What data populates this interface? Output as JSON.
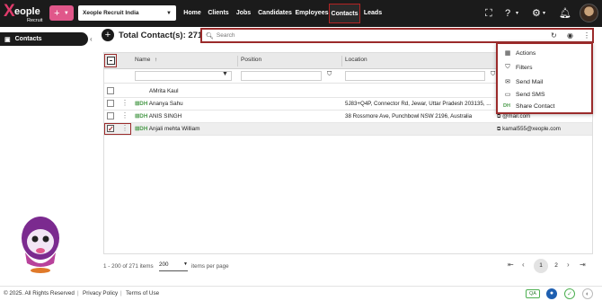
{
  "app": {
    "logo_main": "Xeople",
    "logo_x": "X",
    "logo_word": "eople",
    "logo_sub": "Recruit",
    "company": "Xeople Recruit India"
  },
  "nav": {
    "items": [
      {
        "label": "Home"
      },
      {
        "label": "Clients"
      },
      {
        "label": "Jobs"
      },
      {
        "label": "Candidates"
      },
      {
        "label": "Employees"
      },
      {
        "label": "Contacts",
        "active": true
      },
      {
        "label": "Leads"
      }
    ]
  },
  "sidebar": {
    "contacts_label": "Contacts"
  },
  "page": {
    "title": "Total Contact(s): 271"
  },
  "search": {
    "placeholder": "Search"
  },
  "grid": {
    "columns": {
      "name": "Name",
      "position": "Position",
      "location": "Location"
    },
    "rows": [
      {
        "name": "AMrita Kaul",
        "prefix": "",
        "location": "",
        "email": "",
        "selected": false
      },
      {
        "name": "Ananya Sahu",
        "prefix": "DH",
        "location": "5J83+Q4P, Connector Rd, Jewar, Uttar Pradesh 203135, ...",
        "email": "",
        "selected": false
      },
      {
        "name": "ANIS SINGH",
        "prefix": "DH",
        "location": "38 Rossmore Ave, Punchbowl NSW 2196, Australia",
        "email": "@mail.com",
        "selected": false
      },
      {
        "name": "Anjali mehta William",
        "prefix": "DH",
        "location": "",
        "email": "kamal555@xeople.com",
        "selected": true
      }
    ]
  },
  "pagination": {
    "info": "1 - 200 of 271 items",
    "page_size": "200",
    "per_page_label": "items per page",
    "pages": [
      "1",
      "2"
    ],
    "current": "1"
  },
  "menu": {
    "items": [
      {
        "label": "Actions",
        "icon": "grid-icon"
      },
      {
        "label": "Filters",
        "icon": "filter-icon"
      },
      {
        "label": "Send Mail",
        "icon": "mail-icon"
      },
      {
        "label": "Send SMS",
        "icon": "sms-icon"
      },
      {
        "label": "Share Contact",
        "icon": "dh-icon",
        "prefix": "DH"
      }
    ]
  },
  "footer": {
    "copyright": "© 2025. All Rights Reserved",
    "privacy": "Privacy Policy",
    "terms": "Terms of Use",
    "qa": "QA"
  },
  "colors": {
    "topbar": "#1b1b1b",
    "accent_pink": "#e0578a",
    "highlight_red": "#9b2b2b",
    "dh_green": "#4a9a4a"
  }
}
